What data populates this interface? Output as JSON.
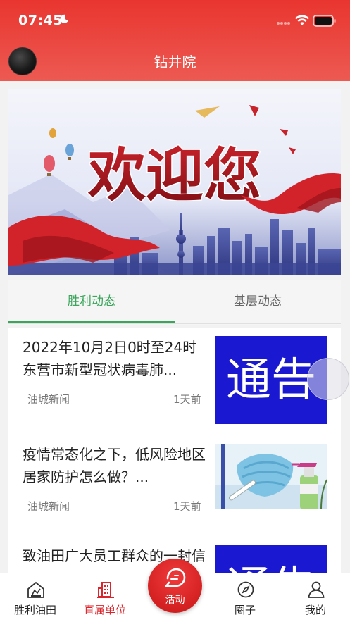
{
  "status_bar": {
    "time": "07:45",
    "icons": [
      "moon-icon",
      "signal-dots-icon",
      "wifi-icon",
      "battery-icon"
    ]
  },
  "header": {
    "title": "钻井院",
    "accent_color": "#e9352f"
  },
  "banner": {
    "headline": "欢迎您"
  },
  "tabs": [
    {
      "label": "胜利动态",
      "active": true
    },
    {
      "label": "基层动态",
      "active": false
    }
  ],
  "tab_active_color": "#3ba55c",
  "news": [
    {
      "title": "2022年10月2日0时至24时东营市新型冠状病毒肺...",
      "source": "油城新闻",
      "time": "1天前",
      "thumb": "notice",
      "thumb_text": "通告"
    },
    {
      "title": "疫情常态化之下，低风险地区居家防护怎么做？...",
      "source": "油城新闻",
      "time": "1天前",
      "thumb": "mask-spray",
      "thumb_text": ""
    },
    {
      "title": "致油田广大员工群众的一封信",
      "source": "",
      "time": "",
      "thumb": "notice",
      "thumb_text": "通告"
    }
  ],
  "tabbar": {
    "items": [
      {
        "label": "胜利油田",
        "icon": "oilfield-icon",
        "active": false
      },
      {
        "label": "直属单位",
        "icon": "building-icon",
        "active": true
      },
      {
        "label": "活动",
        "icon": "activity-icon",
        "active": false
      },
      {
        "label": "圈子",
        "icon": "compass-icon",
        "active": false
      },
      {
        "label": "我的",
        "icon": "person-icon",
        "active": false
      }
    ],
    "active_color": "#d9252b"
  }
}
